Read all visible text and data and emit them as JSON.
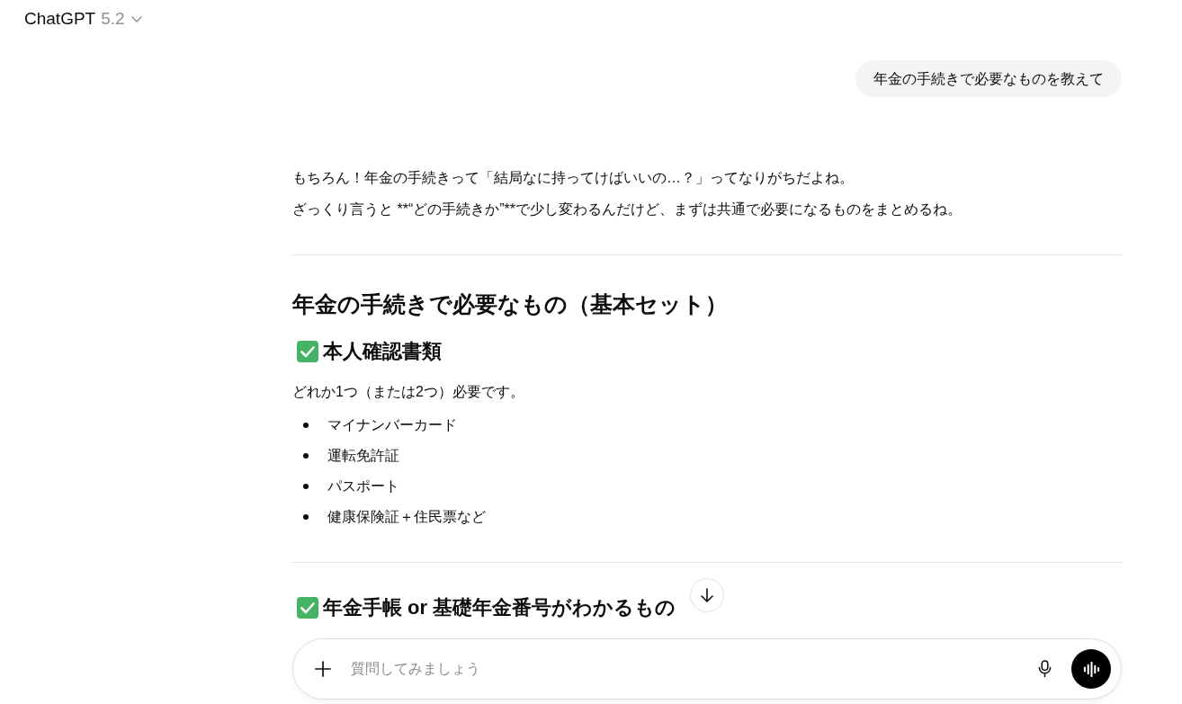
{
  "header": {
    "model_name": "ChatGPT",
    "model_version": "5.2"
  },
  "messages": [
    {
      "kind": "user",
      "text": "年金の手続きで必要なものを教えて"
    },
    {
      "kind": "assistant",
      "blocks": [
        {
          "kind": "paragraph",
          "text": "もちろん！年金の手続きって「結局なに持ってけばいいの…？」ってなりがちだよね。"
        },
        {
          "kind": "paragraph",
          "text": "ざっくり言うと **“どの手続きか”**で少し変わるんだけど、まずは共通で必要になるものをまとめるね。"
        },
        {
          "kind": "divider"
        },
        {
          "kind": "heading",
          "text": "年金の手続きで必要なもの（基本セット）"
        },
        {
          "kind": "check_heading",
          "text": "本人確認書類"
        },
        {
          "kind": "paragraph",
          "text": "どれか1つ（または2つ）必要です。"
        },
        {
          "kind": "list",
          "items": [
            "マイナンバーカード",
            "運転免許証",
            "パスポート",
            "健康保険証＋住民票など"
          ]
        },
        {
          "kind": "divider"
        },
        {
          "kind": "check_heading",
          "text": "年金手帳 or 基礎年金番号がわかるもの"
        }
      ]
    }
  ],
  "composer": {
    "placeholder": "質問してみましょう"
  }
}
